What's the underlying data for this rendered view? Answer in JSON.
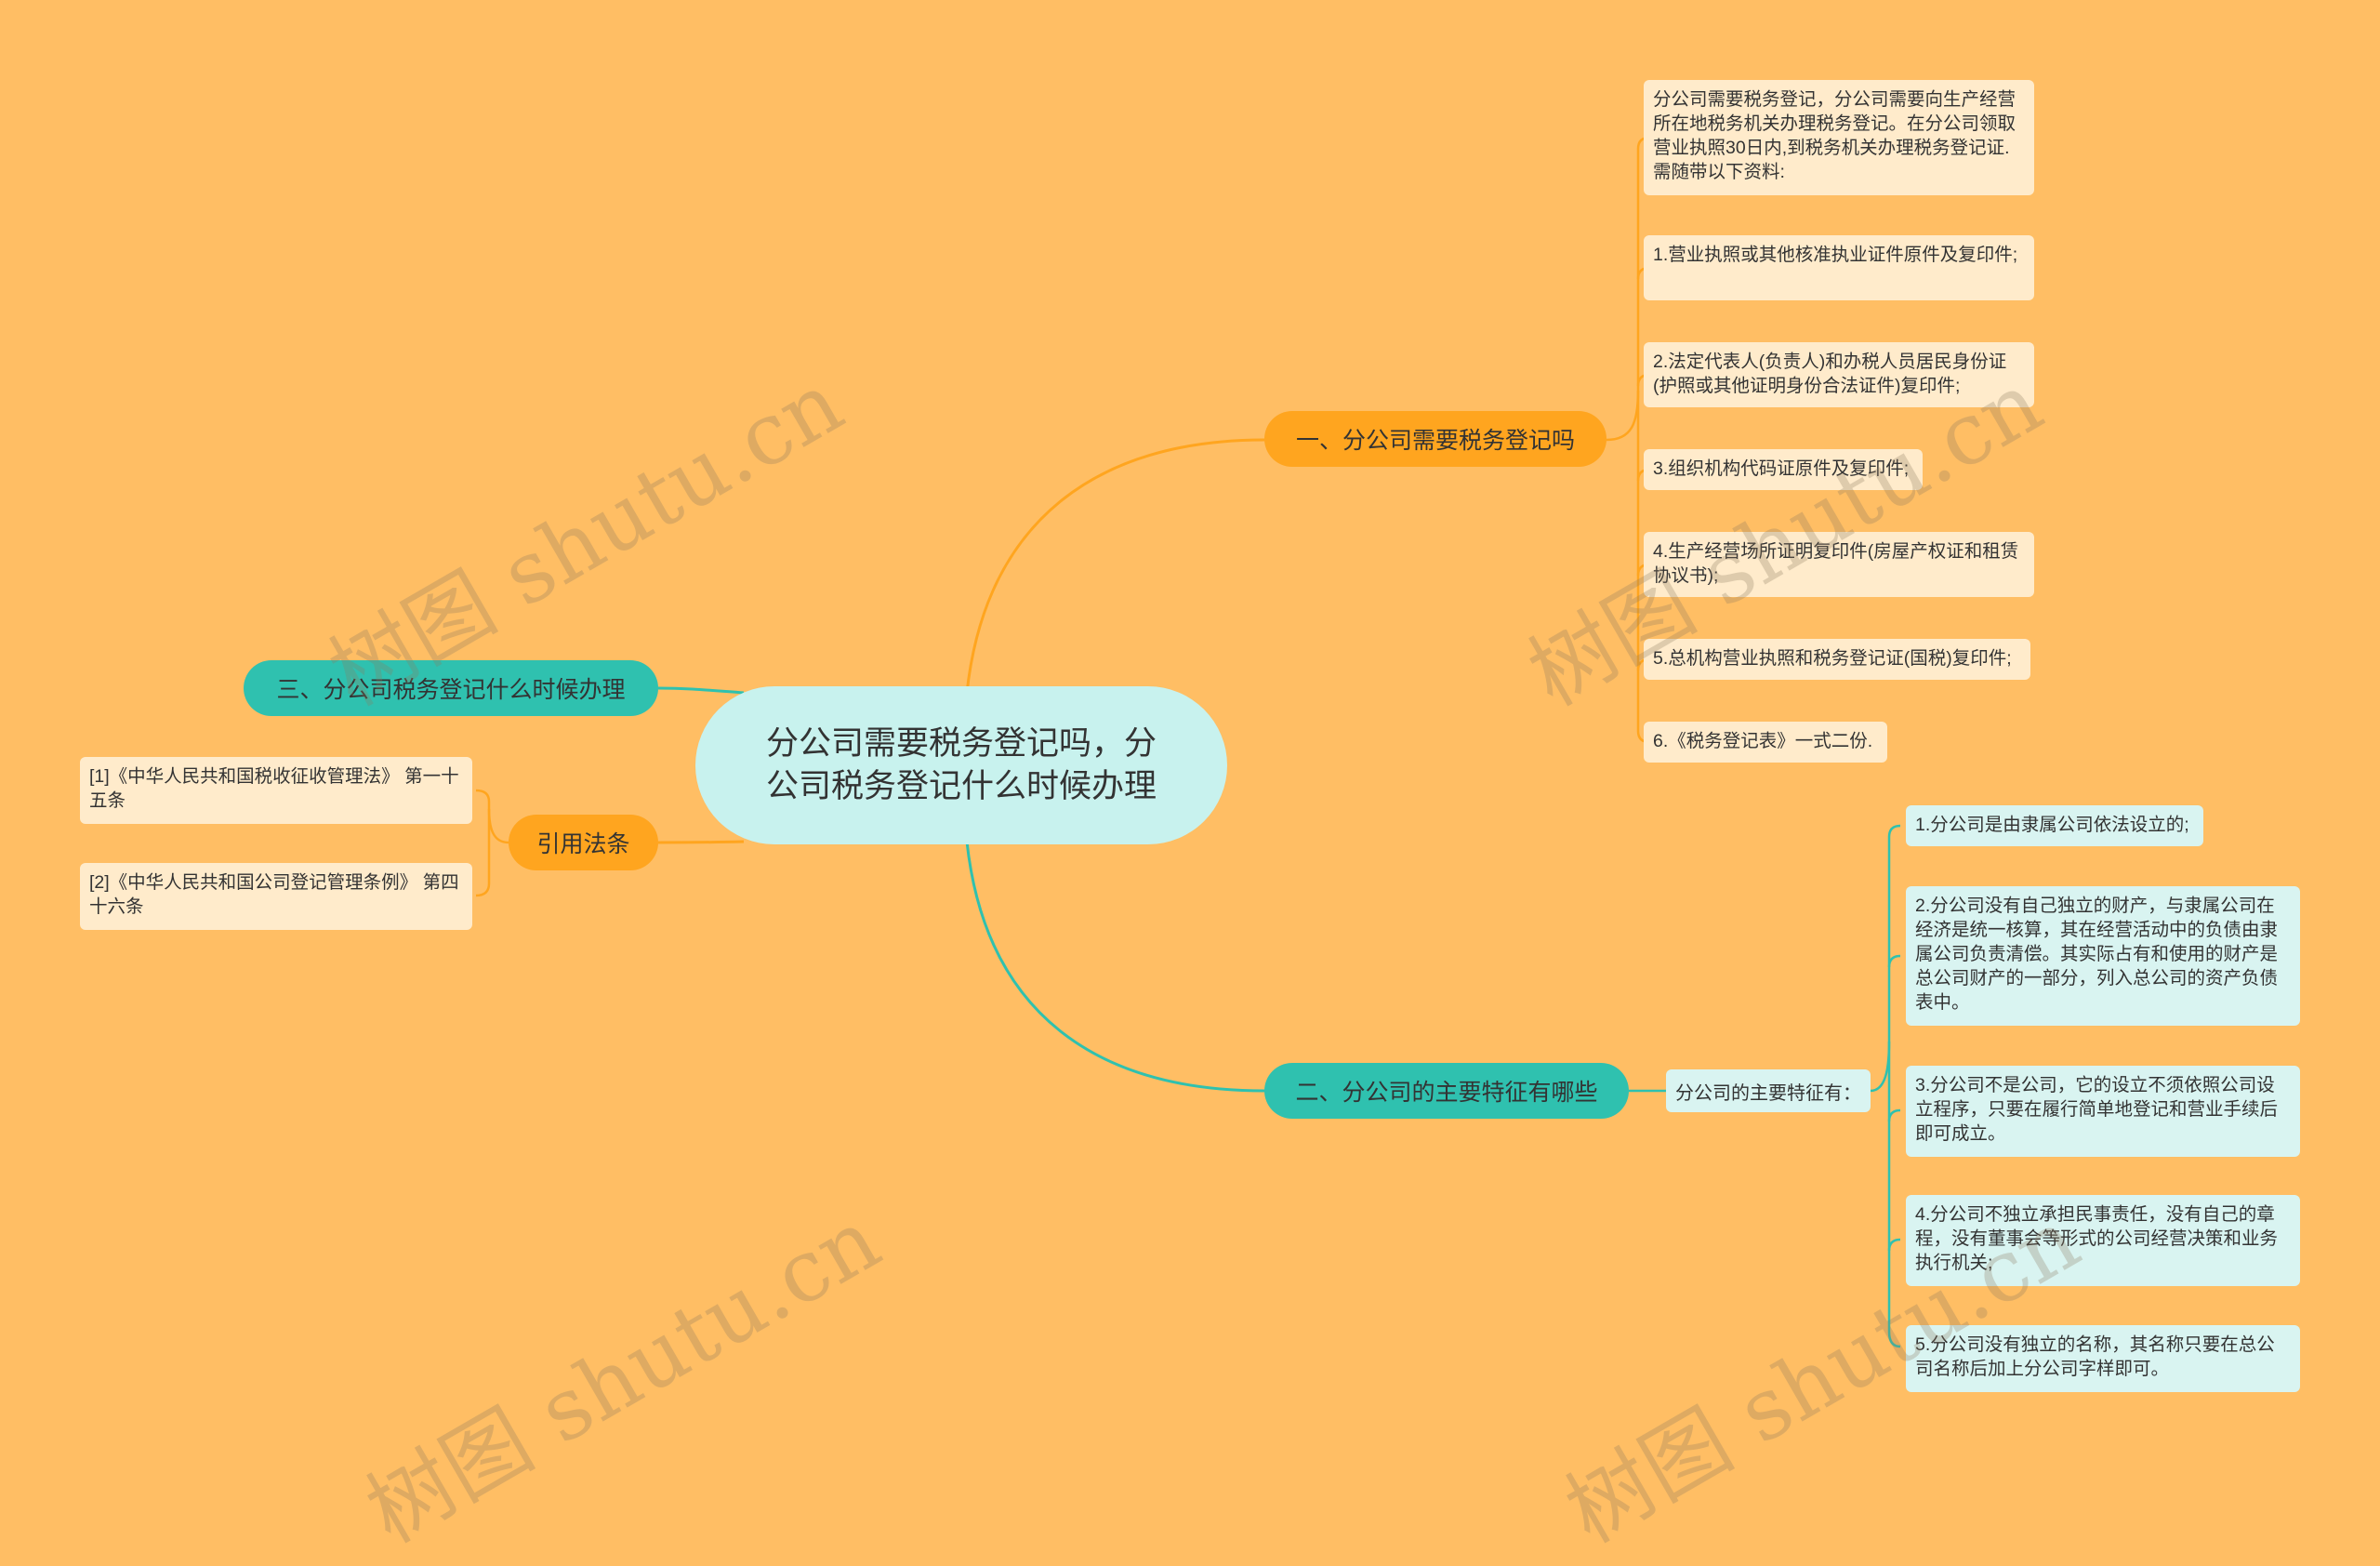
{
  "root": {
    "title": "分公司需要税务登记吗，分公司税务登记什么时候办理"
  },
  "branches": {
    "b1": {
      "label": "一、分公司需要税务登记吗",
      "leaves": [
        "分公司需要税务登记，分公司需要向生产经营所在地税务机关办理税务登记。在分公司领取营业执照30日内,到税务机关办理税务登记证.需随带以下资料:",
        "1.营业执照或其他核准执业证件原件及复印件;",
        "2.法定代表人(负责人)和办税人员居民身份证(护照或其他证明身份合法证件)复印件;",
        "3.组织机构代码证原件及复印件;",
        "4.生产经营场所证明复印件(房屋产权证和租赁协议书);",
        "5.总机构营业执照和税务登记证(国税)复印件;",
        "6.《税务登记表》一式二份."
      ]
    },
    "b2": {
      "label": "二、分公司的主要特征有哪些",
      "sub": "分公司的主要特征有：",
      "leaves": [
        "1.分公司是由隶属公司依法设立的;",
        "2.分公司没有自己独立的财产，与隶属公司在经济是统一核算，其在经营活动中的负债由隶属公司负责清偿。其实际占有和使用的财产是总公司财产的一部分，列入总公司的资产负债表中。",
        "3.分公司不是公司，它的设立不须依照公司设立程序，只要在履行简单地登记和营业手续后即可成立。",
        "4.分公司不独立承担民事责任，没有自己的章程，没有董事会等形式的公司经营决策和业务执行机关;",
        "5.分公司没有独立的名称，其名称只要在总公司名称后加上分公司字样即可。"
      ]
    },
    "b3": {
      "label": "三、分公司税务登记什么时候办理"
    },
    "b4": {
      "label": "引用法条",
      "leaves": [
        "[1]《中华人民共和国税收征收管理法》 第一十五条",
        "[2]《中华人民共和国公司登记管理条例》 第四十六条"
      ]
    }
  },
  "watermark": "树图 shutu.cn",
  "colors": {
    "background": "#FFBE64",
    "root": "#C8F2EE",
    "orange_branch": "#FFA51F",
    "teal_branch": "#2FC1AF",
    "cream_leaf": "#FFEBCB",
    "cyan_leaf": "#D9F4F1"
  }
}
